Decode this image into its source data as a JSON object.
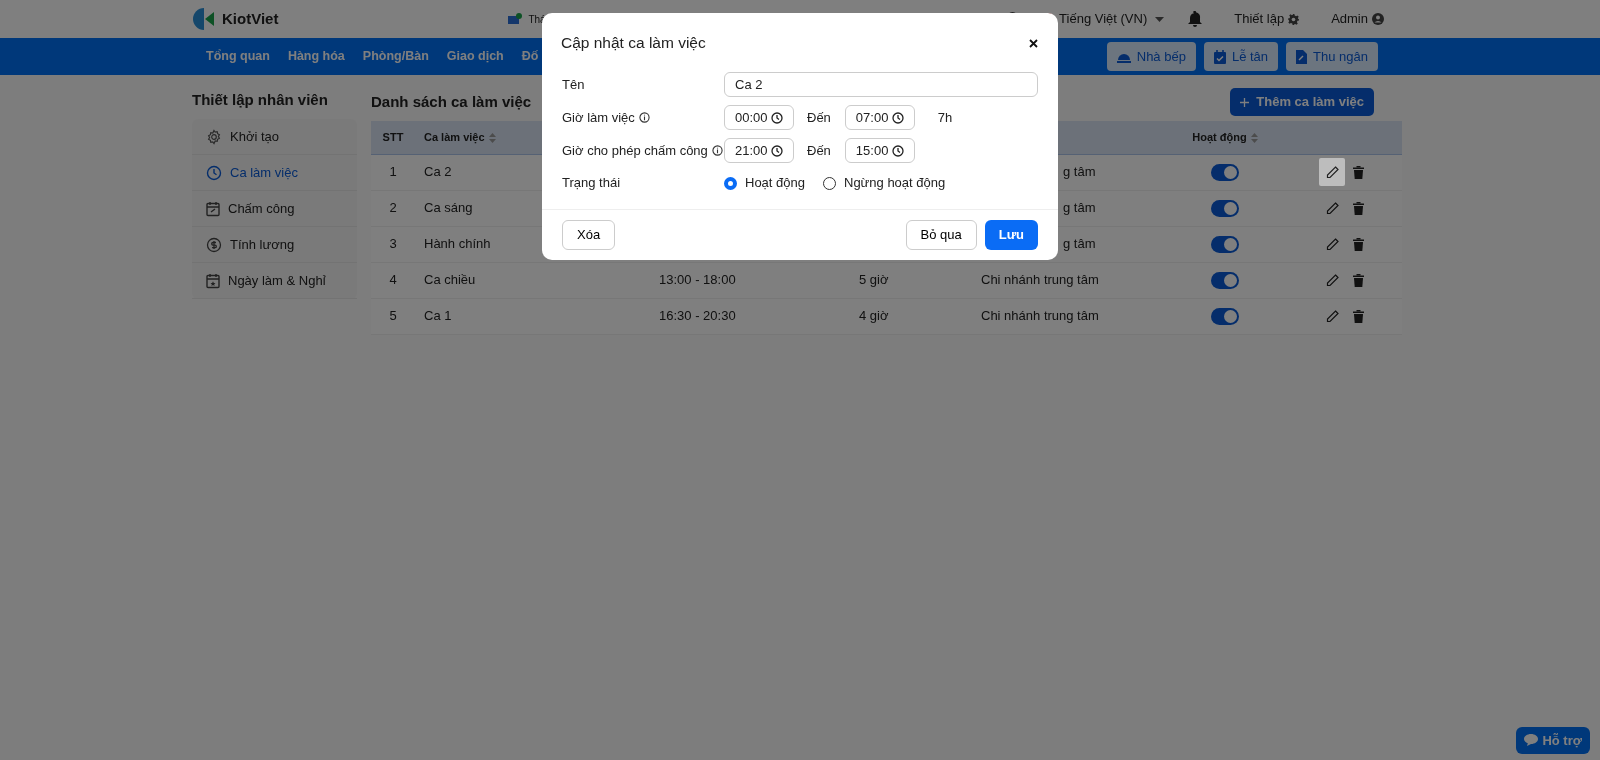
{
  "header": {
    "brand": "KiotViet",
    "notice": "Thá",
    "language": "Tiếng Việt (VN)",
    "settings": "Thiết lập",
    "user": "Admin"
  },
  "nav": {
    "items": [
      "Tổng quan",
      "Hàng hóa",
      "Phòng/Bàn",
      "Giao dịch",
      "Đố"
    ],
    "actions": [
      {
        "kind": "kitchen",
        "label": "Nhà bếp"
      },
      {
        "kind": "reception",
        "label": "Lễ tân"
      },
      {
        "kind": "cashier",
        "label": "Thu ngân"
      }
    ]
  },
  "sidebar": {
    "title": "Thiết lập nhân viên",
    "items": [
      {
        "kind": "gear",
        "label": "Khởi tạo",
        "selected": false
      },
      {
        "kind": "clock",
        "label": "Ca làm việc",
        "selected": true
      },
      {
        "kind": "calendar-check",
        "label": "Chấm công",
        "selected": false
      },
      {
        "kind": "dollar",
        "label": "Tính lương",
        "selected": false
      },
      {
        "kind": "calendar-star",
        "label": "Ngày làm & Nghỉ",
        "selected": false
      }
    ]
  },
  "list": {
    "title": "Danh sách ca làm việc",
    "add_button": "Thêm ca làm việc",
    "columns": [
      "STT",
      "Ca làm việc",
      "Hoạt động"
    ],
    "rows": [
      {
        "index": "1",
        "name": "Ca 2",
        "branch": "g tâm",
        "active": true,
        "hovered": true
      },
      {
        "index": "2",
        "name": "Ca sáng",
        "branch": "g tâm",
        "active": true,
        "hovered": false
      },
      {
        "index": "3",
        "name": "Hành chính",
        "branch": "g tâm",
        "active": true,
        "hovered": false
      },
      {
        "index": "4",
        "name": "Ca chiều",
        "time": "13:00 - 18:00",
        "duration": "5 giờ",
        "branch": "Chi nhánh trung tâm",
        "active": true,
        "hovered": false
      },
      {
        "index": "5",
        "name": "Ca 1",
        "time": "16:30 - 20:30",
        "duration": "4 giờ",
        "branch": "Chi nhánh trung tâm",
        "active": true,
        "hovered": false
      }
    ]
  },
  "dialog": {
    "title": "Cập nhật ca làm việc",
    "name_label": "Tên",
    "name_value": "Ca 2",
    "work_label": "Giờ làm việc",
    "work_from": "00:00",
    "to_label_1": "Đến",
    "work_to": "07:00",
    "work_total": "7h",
    "check_label": "Giờ cho phép chấm công",
    "check_from": "21:00",
    "to_label_2": "Đến",
    "check_to": "15:00",
    "status_label": "Trạng thái",
    "status_options": [
      {
        "label": "Hoạt động",
        "selected": true
      },
      {
        "label": "Ngừng hoạt động",
        "selected": false
      }
    ],
    "delete_button": "Xóa",
    "cancel_button": "Bỏ qua",
    "save_button": "Lưu"
  },
  "help_button": "Hỗ trợ"
}
